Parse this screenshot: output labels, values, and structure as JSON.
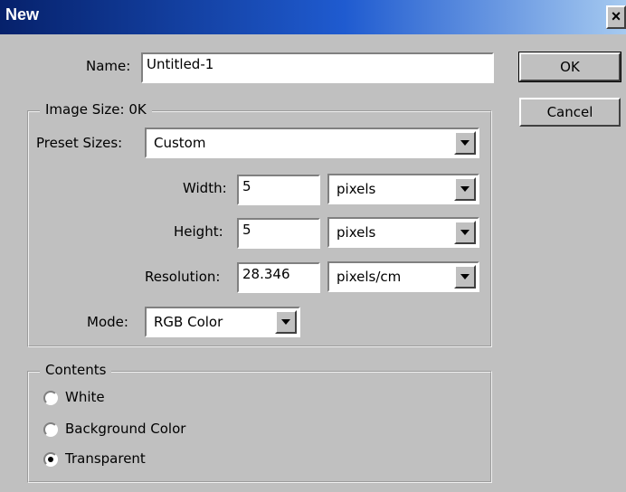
{
  "window": {
    "title": "New",
    "close_glyph": "×"
  },
  "name": {
    "label": "Name:",
    "value": "Untitled-1"
  },
  "buttons": {
    "ok": "OK",
    "cancel": "Cancel"
  },
  "image_size": {
    "title": "Image Size: 0K",
    "preset": {
      "label": "Preset Sizes:",
      "value": "Custom"
    },
    "width": {
      "label": "Width:",
      "value": "5",
      "unit": "pixels"
    },
    "height": {
      "label": "Height:",
      "value": "5",
      "unit": "pixels"
    },
    "resolution": {
      "label": "Resolution:",
      "value": "28.346",
      "unit": "pixels/cm"
    },
    "mode": {
      "label": "Mode:",
      "value": "RGB Color"
    }
  },
  "contents": {
    "title": "Contents",
    "options": [
      {
        "label": "White",
        "selected": false
      },
      {
        "label": "Background Color",
        "selected": false
      },
      {
        "label": "Transparent",
        "selected": true
      }
    ]
  },
  "icons": {
    "close": "close-icon",
    "dropdown": "chevron-down-icon"
  }
}
